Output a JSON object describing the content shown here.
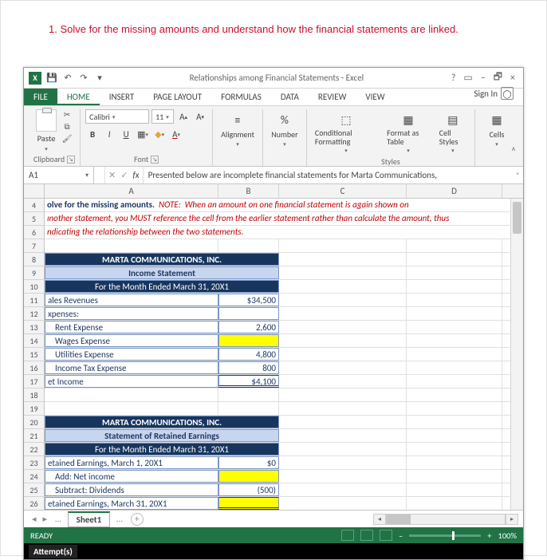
{
  "instruction": "1. Solve for the missing amounts and understand how the financial statements are linked.",
  "window": {
    "title": "Relationships among Financial Statements - Excel",
    "help": "?",
    "min": "–",
    "restore": "🗗",
    "close": "×",
    "sign_in": "Sign In"
  },
  "tabs": {
    "file": "FILE",
    "home": "HOME",
    "insert": "INSERT",
    "page_layout": "PAGE LAYOUT",
    "formulas": "FORMULAS",
    "data": "DATA",
    "review": "REVIEW",
    "view": "VIEW"
  },
  "ribbon": {
    "paste": "Paste",
    "clipboard": "Clipboard",
    "font_name": "Calibri",
    "font_size": "11",
    "font": "Font",
    "alignment": "Alignment",
    "number_sym": "%",
    "number": "Number",
    "conditional": "Conditional Formatting",
    "formatas": "Format as Table",
    "cellstyles": "Cell Styles",
    "styles": "Styles",
    "cells": "Cells"
  },
  "namebox": "A1",
  "formula": "Presented below are incomplete financial statements for Marta Communications,",
  "cols": {
    "A": "A",
    "B": "B",
    "C": "C",
    "D": "D"
  },
  "note": {
    "l1": "olve for the missing amounts.  NOTE:  When an amount on one financial statement is again shown on",
    "l2": "ɪnother statement, you MUST reference the cell from the earlier statement rather than calculate the amount, thus",
    "l3": "ndicating the relationship between the two statements."
  },
  "is": {
    "company": "MARTA COMMUNICATIONS, INC.",
    "stmt": "Income Statement",
    "period": "For the Month Ended  March 31, 20X1",
    "r11a": "ales Revenues",
    "r11b": "$34,500",
    "r12a": "xpenses:",
    "r13a": "Rent Expense",
    "r13b": "2,600",
    "r14a": "Wages Expense",
    "r15a": "Utilities Expense",
    "r15b": "4,800",
    "r16a": "Income Tax Expense",
    "r16b": "800",
    "r17a": "et Income",
    "r17b": "$4,100"
  },
  "re": {
    "company": "MARTA COMMUNICATIONS, INC.",
    "stmt": "Statement of Retained Earnings",
    "period": "For the Month Ended  March 31, 20X1",
    "r23a": "etained Earnings, March 1, 20X1",
    "r23b": "$0",
    "r24a": "Add: Net income",
    "r25a": "Subtract: Dividends",
    "r25b": "(500)",
    "r26a": "etained Earnings, March 31, 20X1"
  },
  "sheet": {
    "name": "Sheet1",
    "dots": "…",
    "plus": "+"
  },
  "status": {
    "ready": "READY",
    "zoom": "100%"
  },
  "attempt": "Attempt(s)"
}
